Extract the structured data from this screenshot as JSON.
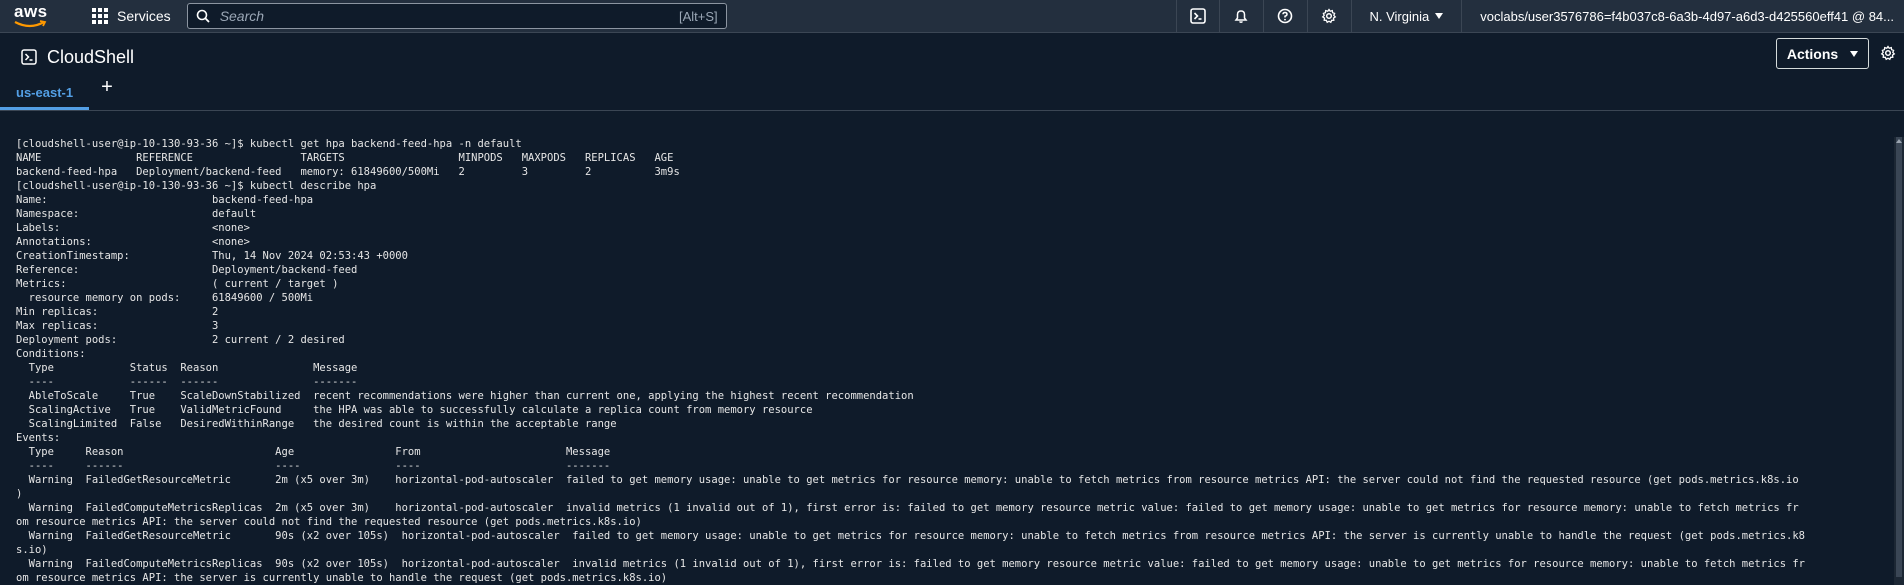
{
  "topnav": {
    "logo_text": "aws",
    "services_label": "Services",
    "search_placeholder": "Search",
    "search_shortcut": "[Alt+S]",
    "region": "N. Virginia",
    "account": "voclabs/user3576786=f4b037c8-6a3b-4d97-a6d3-d425560eff41 @ 84..."
  },
  "header": {
    "title": "CloudShell",
    "actions_label": "Actions"
  },
  "tabs": [
    {
      "label": "us-east-1",
      "active": true
    }
  ],
  "add_tab_label": "+",
  "terminal": {
    "lines": [
      "[cloudshell-user@ip-10-130-93-36 ~]$ kubectl get hpa backend-feed-hpa -n default",
      "NAME               REFERENCE                 TARGETS                  MINPODS   MAXPODS   REPLICAS   AGE",
      "backend-feed-hpa   Deployment/backend-feed   memory: 61849600/500Mi   2         3         2          3m9s",
      "[cloudshell-user@ip-10-130-93-36 ~]$ kubectl describe hpa",
      "Name:                          backend-feed-hpa",
      "Namespace:                     default",
      "Labels:                        <none>",
      "Annotations:                   <none>",
      "CreationTimestamp:             Thu, 14 Nov 2024 02:53:43 +0000",
      "Reference:                     Deployment/backend-feed",
      "Metrics:                       ( current / target )",
      "  resource memory on pods:     61849600 / 500Mi",
      "Min replicas:                  2",
      "Max replicas:                  3",
      "Deployment pods:               2 current / 2 desired",
      "Conditions:",
      "  Type            Status  Reason               Message",
      "  ----            ------  ------               -------",
      "  AbleToScale     True    ScaleDownStabilized  recent recommendations were higher than current one, applying the highest recent recommendation",
      "  ScalingActive   True    ValidMetricFound     the HPA was able to successfully calculate a replica count from memory resource",
      "  ScalingLimited  False   DesiredWithinRange   the desired count is within the acceptable range",
      "Events:",
      "  Type     Reason                        Age                From                       Message",
      "  ----     ------                        ----               ----                       -------",
      "  Warning  FailedGetResourceMetric       2m (x5 over 3m)    horizontal-pod-autoscaler  failed to get memory usage: unable to get metrics for resource memory: unable to fetch metrics from resource metrics API: the server could not find the requested resource (get pods.metrics.k8s.io",
      ")",
      "  Warning  FailedComputeMetricsReplicas  2m (x5 over 3m)    horizontal-pod-autoscaler  invalid metrics (1 invalid out of 1), first error is: failed to get memory resource metric value: failed to get memory usage: unable to get metrics for resource memory: unable to fetch metrics fr",
      "om resource metrics API: the server could not find the requested resource (get pods.metrics.k8s.io)",
      "  Warning  FailedGetResourceMetric       90s (x2 over 105s)  horizontal-pod-autoscaler  failed to get memory usage: unable to get metrics for resource memory: unable to fetch metrics from resource metrics API: the server is currently unable to handle the request (get pods.metrics.k8",
      "s.io)",
      "  Warning  FailedComputeMetricsReplicas  90s (x2 over 105s)  horizontal-pod-autoscaler  invalid metrics (1 invalid out of 1), first error is: failed to get memory resource metric value: failed to get memory usage: unable to get metrics for resource memory: unable to fetch metrics fr",
      "om resource metrics API: the server is currently unable to handle the request (get pods.metrics.k8s.io)"
    ]
  },
  "colors": {
    "nav_bg": "#232f3e",
    "page_bg": "#0f1b2a",
    "accent": "#539fe5"
  },
  "icons": [
    "aws-logo",
    "services-grid-icon",
    "search-icon",
    "cloudshell-icon",
    "bell-icon",
    "help-icon",
    "gear-icon",
    "chevron-down-icon",
    "plus-icon"
  ]
}
